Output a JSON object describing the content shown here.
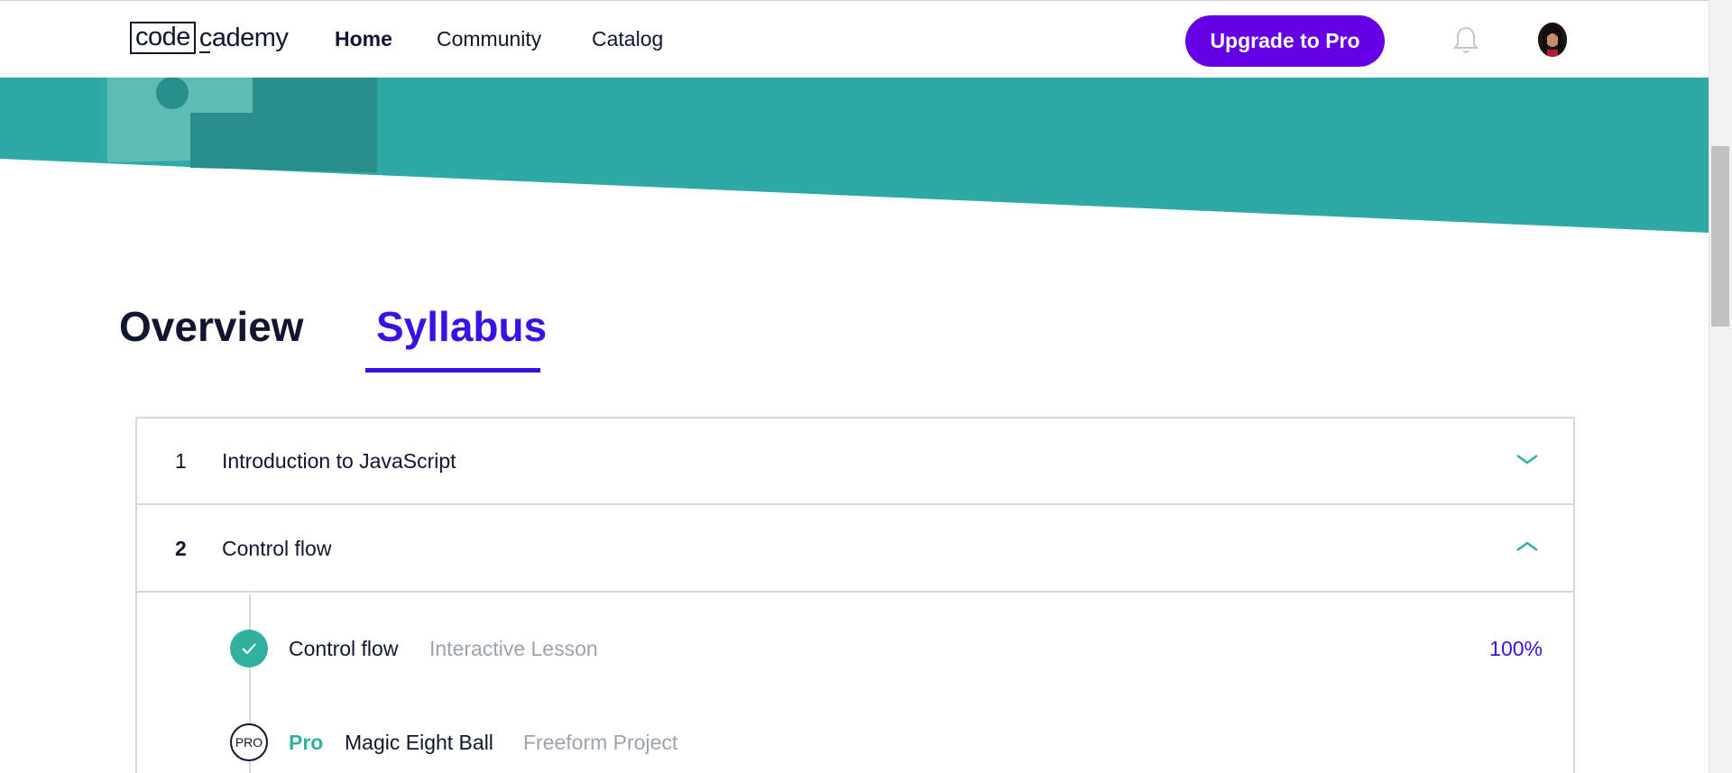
{
  "header": {
    "logo_code": "code",
    "logo_rest": "cademy",
    "nav": [
      "Home",
      "Community",
      "Catalog"
    ],
    "upgrade_label": "Upgrade to Pro",
    "bell_icon": "bell-icon",
    "avatar": "user-avatar"
  },
  "tabs": {
    "overview": "Overview",
    "syllabus": "Syllabus",
    "active": "Syllabus"
  },
  "syllabus": {
    "modules": [
      {
        "number": "1",
        "title": "Introduction to JavaScript",
        "expanded": false,
        "icon": "chevron-down-icon"
      },
      {
        "number": "2",
        "title": "Control flow",
        "expanded": true,
        "icon": "chevron-up-icon"
      }
    ],
    "lessons": [
      {
        "title": "Control flow",
        "type": "Interactive Lesson",
        "progress": "100%",
        "status_icon": "check-icon"
      },
      {
        "badge": "PRO",
        "pro_label": "Pro",
        "title": "Magic Eight Ball",
        "type": "Freeform Project",
        "status_icon": "pro-badge-icon"
      }
    ]
  },
  "colors": {
    "brand_purple": "#6400e4",
    "accent_blue": "#3a10e5",
    "teal": "#31b09e",
    "banner_teal": "#2ea9a5",
    "navy": "#10162f"
  }
}
